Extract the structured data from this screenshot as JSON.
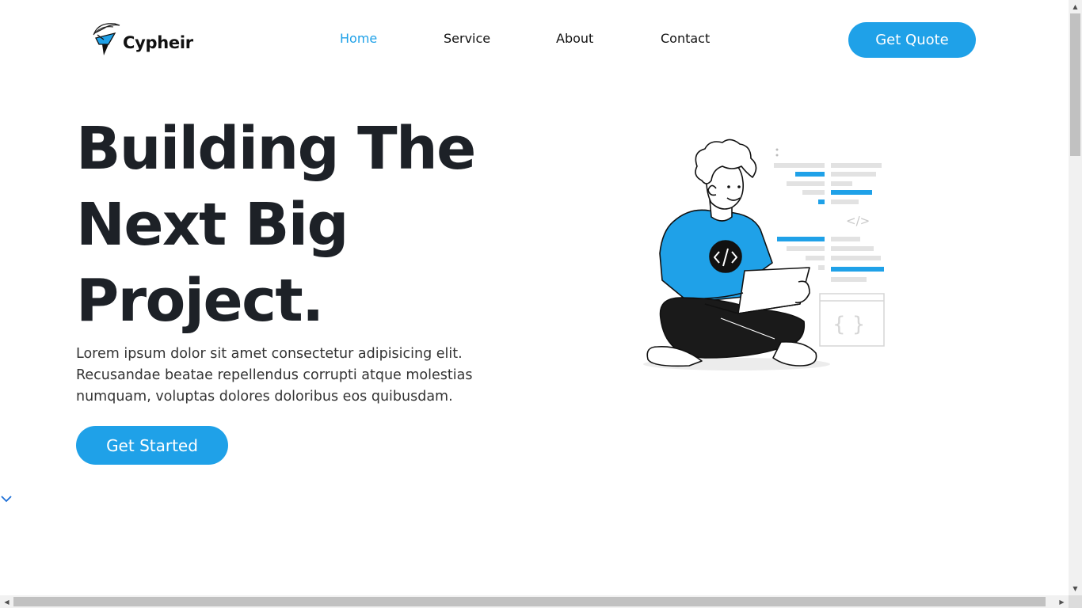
{
  "brand": {
    "name": "Cypheir"
  },
  "nav": {
    "items": [
      {
        "label": "Home",
        "active": true
      },
      {
        "label": "Service",
        "active": false
      },
      {
        "label": "About",
        "active": false
      },
      {
        "label": "Contact",
        "active": false
      }
    ],
    "cta_label": "Get Quote"
  },
  "hero": {
    "title_lines": [
      "Building The",
      "Next Big",
      "Project."
    ],
    "description": "Lorem ipsum dolor sit amet consectetur adipisicing elit. Recusandae beatae repellendus corrupti atque molestias numquam, voluptas dolores doloribus eos quibusdam.",
    "cta_label": "Get Started"
  },
  "illustration": {
    "code_tag": "</>",
    "braces": "{ }",
    "icon": "developer-with-laptop-illustration"
  },
  "scroll_indicator": {
    "icon": "chevron-down-icon"
  },
  "colors": {
    "accent": "#1fa1e8",
    "text_dark": "#1d2127",
    "text_body": "#333333"
  }
}
